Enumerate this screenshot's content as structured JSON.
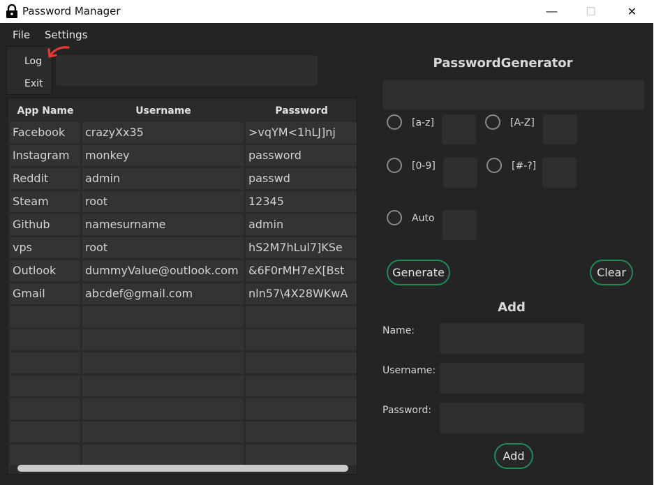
{
  "window": {
    "title": "Password Manager",
    "minimize": "—",
    "maximize": "☐",
    "close": "✕"
  },
  "menu": {
    "file": "File",
    "settings": "Settings",
    "dropdown": [
      "Log",
      "Exit"
    ]
  },
  "table": {
    "headers": [
      "App Name",
      "Username",
      "Password"
    ],
    "rows": [
      [
        "Facebook",
        "crazyXx35",
        ">vqYM<1hLJ]nj"
      ],
      [
        "Instagram",
        "monkey",
        "password"
      ],
      [
        "Reddit",
        "admin",
        "passwd"
      ],
      [
        "Steam",
        "root",
        "12345"
      ],
      [
        "Github",
        "namesurname",
        "admin"
      ],
      [
        "vps",
        "root",
        "hS2M7hLul7]KSe"
      ],
      [
        "Outlook",
        "dummyValue@outlook.com",
        "&6F0rMH7eX[Bst"
      ],
      [
        "Gmail",
        "abcdef@gmail.com",
        "nln57\\4X28WKwA"
      ],
      [
        "",
        "",
        ""
      ],
      [
        "",
        "",
        ""
      ],
      [
        "",
        "",
        ""
      ],
      [
        "",
        "",
        ""
      ],
      [
        "",
        "",
        ""
      ],
      [
        "",
        "",
        ""
      ],
      [
        "",
        "",
        ""
      ]
    ]
  },
  "generator": {
    "title": "PasswordGenerator",
    "options": {
      "lower": "[a-z]",
      "upper": "[A-Z]",
      "digits": "[0-9]",
      "symbols": "[#-?]",
      "auto": "Auto"
    },
    "generate_label": "Generate",
    "clear_label": "Clear"
  },
  "add_form": {
    "title": "Add",
    "name_label": "Name:",
    "username_label": "Username:",
    "password_label": "Password:",
    "add_label": "Add"
  },
  "colors": {
    "background": "#242424",
    "accent": "#1e8a55",
    "annotation_arrow": "#e53935"
  }
}
